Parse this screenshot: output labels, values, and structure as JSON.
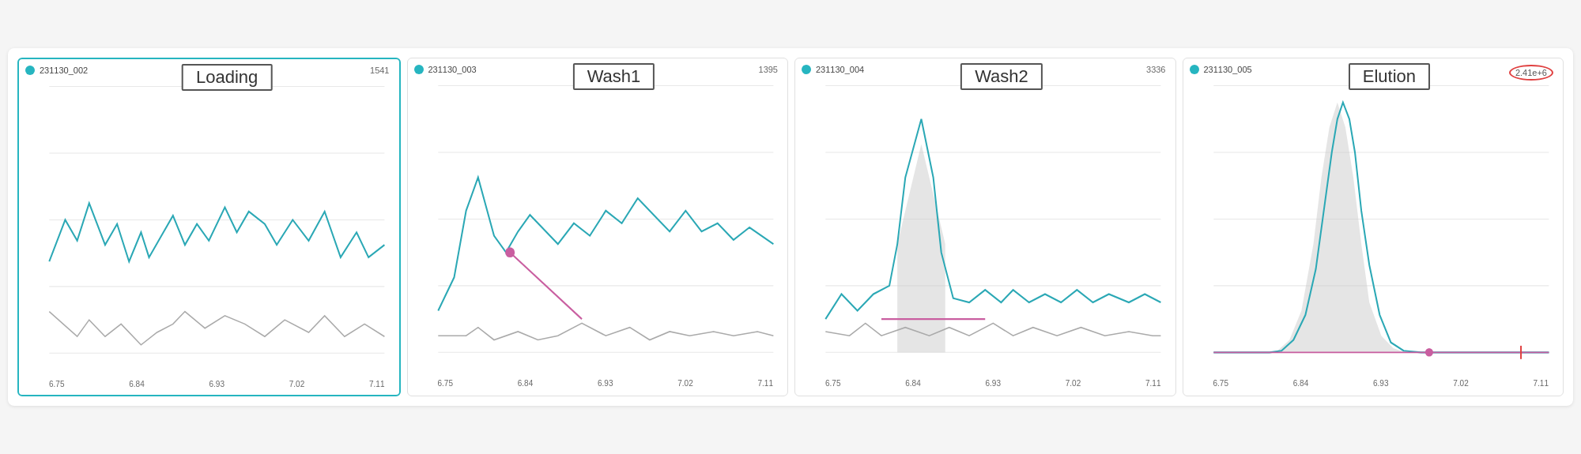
{
  "panels": [
    {
      "id": "231130_002",
      "label": "Loading",
      "maxValue": "1541",
      "maxCircled": false,
      "activeBorder": true,
      "xLabels": [
        "6.75",
        "6.84",
        "6.93",
        "7.02",
        "7.11"
      ]
    },
    {
      "id": "231130_003",
      "label": "Wash1",
      "maxValue": "1395",
      "maxCircled": false,
      "activeBorder": false,
      "xLabels": [
        "6.75",
        "6.84",
        "6.93",
        "7.02",
        "7.11"
      ]
    },
    {
      "id": "231130_004",
      "label": "Wash2",
      "maxValue": "3336",
      "maxCircled": false,
      "activeBorder": false,
      "xLabels": [
        "6.75",
        "6.84",
        "6.93",
        "7.02",
        "7.11"
      ]
    },
    {
      "id": "231130_005",
      "label": "Elution",
      "maxValue": "2.41e+6",
      "maxCircled": true,
      "activeBorder": false,
      "xLabels": [
        "6.75",
        "6.84",
        "6.93",
        "7.02",
        "7.11"
      ]
    }
  ],
  "colors": {
    "teal": "#2ba8b5",
    "gray": "#aaaaaa",
    "pink": "#c95ea0",
    "dot": "#26b5c0",
    "border_active": "#26b5c0",
    "circle_alert": "#e04040"
  }
}
